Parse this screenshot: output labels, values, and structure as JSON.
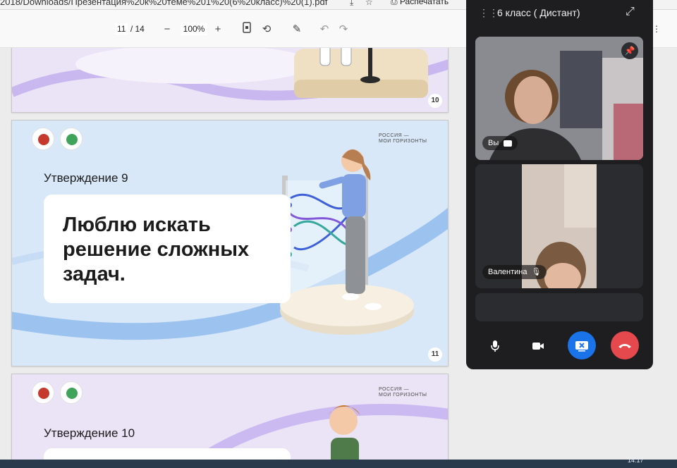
{
  "browser": {
    "url_fragment": "2018/Downloads/Презентация%20к%20теме%201%20(6%20класс)%20(1).pdf",
    "print_label": "Распечатать"
  },
  "pdf_toolbar": {
    "current_page": "11",
    "total_pages": "/ 14",
    "zoom": "100%"
  },
  "slides": {
    "slide10": {
      "number": "10"
    },
    "slide11": {
      "brand_line1": "РОССИЯ —",
      "brand_line2": "МОИ ГОРИЗОНТЫ",
      "statement_label": "Утверждение 9",
      "statement_text": "Люблю искать решение сложных задач.",
      "number": "11"
    },
    "slide12": {
      "brand_line1": "РОССИЯ —",
      "brand_line2": "МОИ ГОРИЗОНТЫ",
      "statement_label": "Утверждение 10"
    }
  },
  "call": {
    "title": "6 класс ( Дистант)",
    "participants": [
      {
        "name": "Вы"
      },
      {
        "name": "Валентина"
      }
    ]
  },
  "taskbar": {
    "clock": "14:17"
  },
  "colors": {
    "accent_blue": "#1a73e8",
    "end_call_red": "#e5484d",
    "slide_lavender": "#ebe4f7",
    "slide_blue": "#d8e8f8"
  }
}
